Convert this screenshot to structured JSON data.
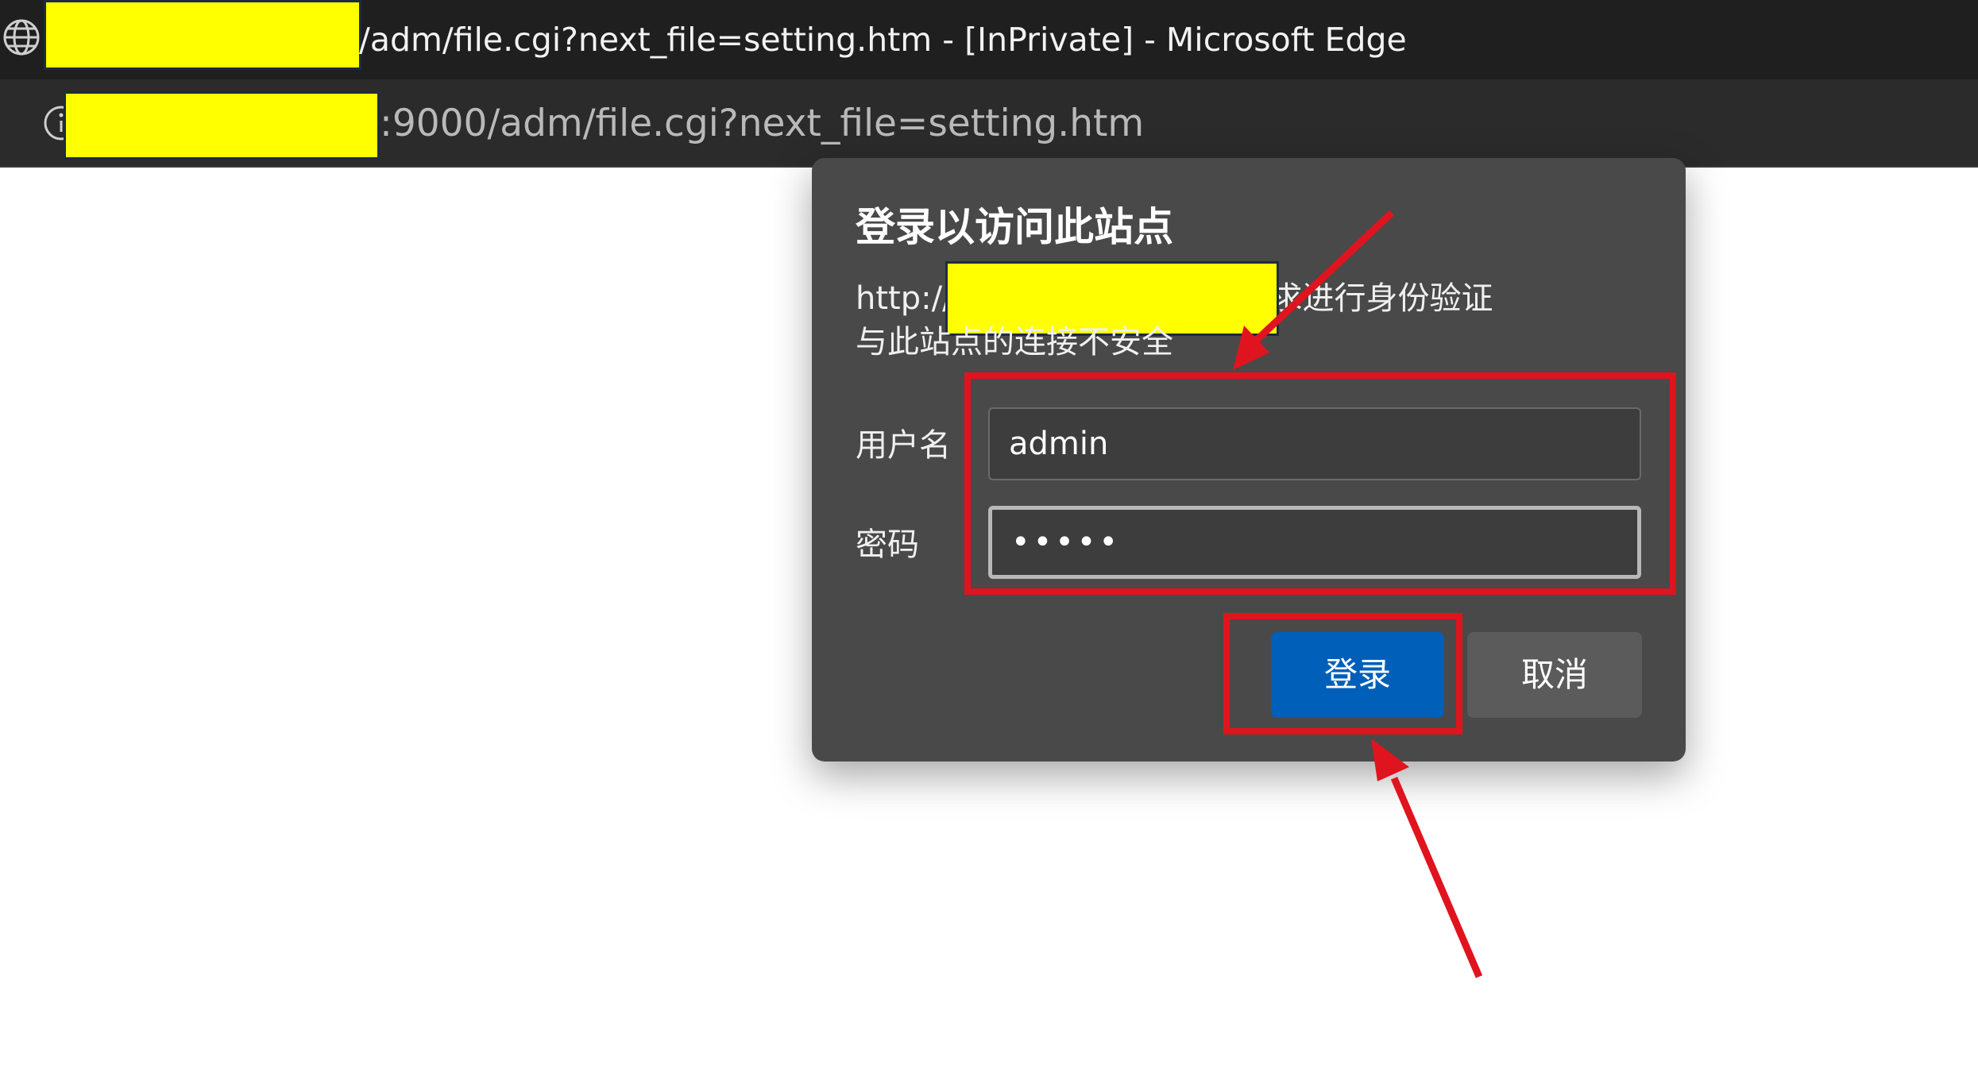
{
  "browser": {
    "title_suffix": "/adm/file.cgi?next_file=setting.htm - [InPrivate] - Microsoft Edge",
    "url_suffix": ":9000/adm/file.cgi?next_file=setting.htm"
  },
  "dialog": {
    "title": "登录以访问此站点",
    "message_prefix": "http://",
    "message_suffix": "要求进行身份验证",
    "security_note": "与此站点的连接不安全",
    "username_label": "用户名",
    "username_value": "admin",
    "password_label": "密码",
    "password_value": "•••••",
    "login_button": "登录",
    "cancel_button": "取消"
  },
  "annotation_colors": {
    "highlight": "#e0141e",
    "redaction": "#ffff00",
    "login_button": "#005fb8"
  }
}
